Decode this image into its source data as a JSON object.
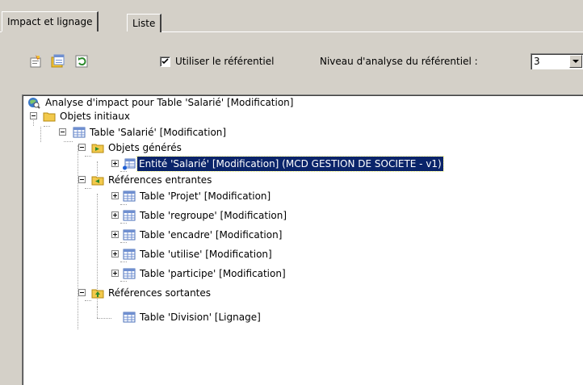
{
  "tabs": [
    {
      "label": "Impact et lignage",
      "active": true
    },
    {
      "label": "Liste",
      "active": false
    }
  ],
  "toolbar": {
    "buttons": [
      "properties-icon",
      "generate-icon",
      "refresh-icon"
    ],
    "use_repository_label": "Utiliser le référentiel",
    "use_repository_checked": true,
    "level_label": "Niveau d'analyse du référentiel :",
    "level_value": "3"
  },
  "tree": {
    "root": "Analyse d'impact pour Table 'Salarié' [Modification]",
    "initial_objects": "Objets initiaux",
    "table_salarie": "Table 'Salarié' [Modification]",
    "generated_objects": "Objets générés",
    "entity_salarie": "Entité 'Salarié' [Modification] (MCD GESTION DE SOCIETE - v1)",
    "incoming_refs": "Références entrantes",
    "incoming": [
      "Table 'Projet' [Modification]",
      "Table 'regroupe' [Modification]",
      "Table 'encadre' [Modification]",
      "Table 'utilise' [Modification]",
      "Table 'participe' [Modification]"
    ],
    "outgoing_refs": "Références sortantes",
    "table_division": "Table 'Division' [Lignage]"
  },
  "colors": {
    "selection": "#0a246a",
    "window": "#d4d0c8",
    "table_icon": "#6f8fd0",
    "folder": "#f2c94c"
  }
}
